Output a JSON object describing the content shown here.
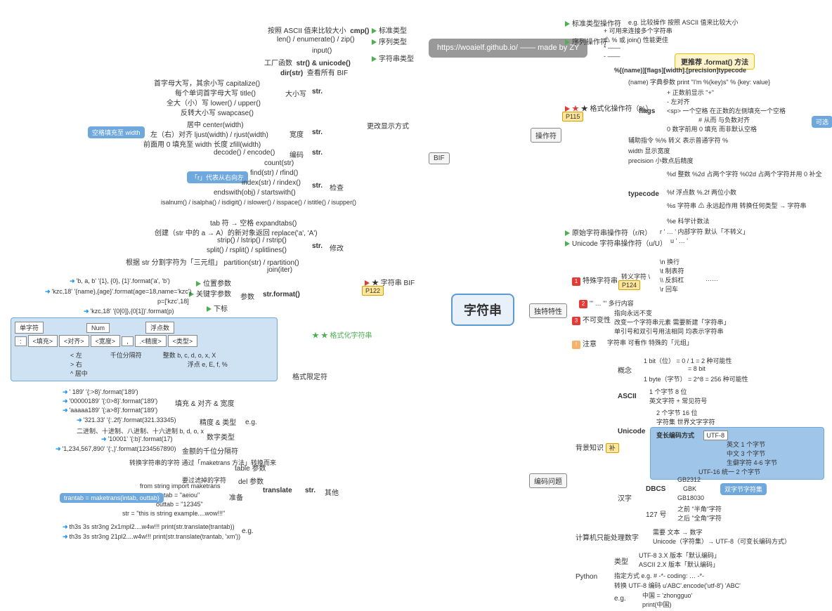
{
  "root": "字符串",
  "watermark": "https://woaielf.github.io/\n—— made by ZY",
  "bif": {
    "title": "BIF",
    "std": {
      "label": "标准类型",
      "items": [
        "按照 ASCII 值来比较大小",
        "cmp()"
      ]
    },
    "seq": {
      "label": "序列类型",
      "item": "len() / enumerate() / zip()"
    },
    "strtype": {
      "label": "字符串类型",
      "input": "input()",
      "factory": "工厂函数",
      "unicode": "str() & unicode()",
      "dir": "dir(str)",
      "dirnote": "查看所有 BIF"
    },
    "str_label": "str.",
    "case": {
      "label": "大小写",
      "items": [
        "首字母大写，其余小写  capitalize()",
        "每个单词首字母大写  title()",
        "全大（小）写  lower() / upper()",
        "反转大小写  swapcase()"
      ]
    },
    "width": {
      "label": "宽度",
      "note": "空格填充至 width",
      "items": [
        "居中  center(width)",
        "左（右）对齐  ljust(width) / rjust(width)",
        "前面用 0 填充至 width 长度  zfill(width)"
      ]
    },
    "encode": {
      "label": "编码",
      "item": "decode() / encode()"
    },
    "display": "更改显示方式",
    "check": {
      "label": "检查",
      "note": "「r」代表从右向左",
      "items": [
        "count(str)",
        "find(str) / rfind()",
        "index(str) / rindex()",
        "endswith(obj) / startswith()",
        "isalnum() / isalpha() / isdigit() / islower() / isspace() / istitle() / isupper()"
      ]
    },
    "modify": {
      "label": "修改",
      "items": [
        "tab 符 → 空格  expandtabs()",
        "创建（str 中的 a → A）的新对象返回  replace('a', 'A')",
        "strip() / lstrip() / rstrip()",
        "split() / rsplit() / splitlines()",
        "根据 str 分割字符为「三元组」  partition(str) / rpartition()",
        "join(iter)"
      ]
    },
    "strbif": {
      "label": "★ 字符串 BIF",
      "tag": "P122"
    }
  },
  "format": {
    "title": "★ 格式化字符串",
    "strformat": "str.format()",
    "param": "参数",
    "pos": {
      "label": "位置参数",
      "ex": "'b, a, b'    '{1}, {0}, {1}'.format('a', 'b')"
    },
    "kw": {
      "label": "关键字参数",
      "ex": "'kzc,18'    '{name},{age}'.format(age=18,name='kzc')"
    },
    "sub": {
      "label": "下标",
      "p": "p=['kzc',18]",
      "ex": "'kzc,18'    '{0[0]},{0[1]}'.format(p)"
    },
    "spec": {
      "label": "格式限定符",
      "header": [
        "单字符",
        "Num",
        "浮点数"
      ],
      "row1": [
        ":",
        "<填充>",
        "<对齐>",
        "<宽度>",
        ",",
        ".<精度>",
        "<类型>"
      ],
      "align": [
        "<  左",
        "千位分隔符",
        "整数  b, c, d, o, x, X",
        "浮点  e, E, f, %",
        "> 右",
        "^ 居中"
      ]
    },
    "eg": {
      "label": "e.g.",
      "fill": "填充 & 对齐 & 宽度",
      "items": [
        "'   189'    '{:>8}'.format('189')",
        "'00000189'    '{:0>8}'.format('189')",
        "'aaaaa189'    '{:a>8}'.format('189')"
      ],
      "prec": "精度 & 类型",
      "prec_ex": "'321.33'    '{:.2f}'.format(321.33345)",
      "numtype": "数字类型",
      "numtype_note": "二进制、十进制、八进制、十六进制  b, d, o, x",
      "numtype_ex": "'10001'    '{:b}'.format(17)",
      "thou": "金额的千位分隔符",
      "thou_ex": "'1,234,567,890'    '{:,}'.format(1234567890)"
    },
    "other": {
      "label": "其他",
      "translate": "translate",
      "tablep": "table 参数",
      "tablep_note": "转换字符串的字符  通过「maketrans 方法」转换而来",
      "delp": "del 参数",
      "delp_note": "要过滤掉的字符",
      "prep": "准备",
      "prep_items": [
        "from string import maketrans",
        "intab = \"aeiou\"",
        "outtab = \"12345\"",
        "str = \"this is string example....wow!!!\""
      ],
      "trantab": "trantab = maketrans(intab, outtab)",
      "eg_items": [
        "th3s 3s str3ng 2x1mpl2....w4w!!!  print(str.translate(trantab))",
        "th3s 3s str3ng 21pl2....w4w!!!  print(str.translate(trantab, 'xm'))"
      ]
    }
  },
  "ops": {
    "title": "操作符",
    "std": {
      "label": "标准类型操作符",
      "eg": "e.g.   比较操作   按照 ASCII 值来比较大小"
    },
    "seq": {
      "label": "序列操作符",
      "plus": "+  可用来连接多个字符串",
      "plusw": "⚠ % 或 join() 性能更佳",
      "star": "*  ——",
      "minus": "-  ——"
    },
    "fmt": {
      "label": "★ 格式化操作符（%）",
      "tag": "P115",
      "rec": "更推荐 .format() 方法",
      "tpl": "%[(name)][flags][width].[precision]typecode",
      "name": "(name)  字典参数  print \"I'm %(key)s\" % {key: value}",
      "flags": "flags",
      "flag_items": [
        "+  正数前显示 \"+\"",
        "-  左对齐",
        "<sp>  一个空格  在正数的左侧填充一个空格",
        "#  从而  与负数对齐",
        "0  数字前用 0 填充  而非默认空格"
      ],
      "opt": "可选",
      "aux": "辅助指令  %%  转义  表示普通字符 %",
      "width": "width  显示宽度",
      "prec": "precision  小数点后精度",
      "typecode": "typecode",
      "tc_items": [
        "%d  整数  %2d  占两个字符    %02d  占两个字符并用 0 补全",
        "%f  浮点数  %.2f  两位小数",
        "%s  字符串  ⚠ 永远起作用  转换任何类型 → 字符串",
        "%e  科学计数法"
      ]
    },
    "raw": {
      "label": "原始字符串操作符（r/R）",
      "ex": "r ' … '   内部字符   默认「不转义」"
    },
    "uni": {
      "label": "Unicode 字符串操作符（u/U）",
      "ex": "u ' … '"
    }
  },
  "unique": {
    "title": "独特特性",
    "esc": {
      "label": "特殊字符串",
      "sub": "转义字符 \\",
      "tag": "P124",
      "items": [
        "\\n  换行",
        "\\t  制表符",
        "\\\\  反斜杠",
        "\\r  回车",
        "……"
      ]
    },
    "triple": "''' … '''  多行内容",
    "immut": {
      "label": "不可变性",
      "items": [
        "指向永远不变",
        "改变一个字符串元素   需要新建「字符串」",
        "单引号和双引号用法相同   均表示字符串"
      ]
    },
    "note": {
      "label": "注意",
      "items": "字符串   可看作   特殊的「元组」"
    }
  },
  "enc": {
    "title": "编码问题",
    "bg": {
      "label": "背景知识",
      "tag": "补"
    },
    "concept": {
      "label": "概念",
      "bit": "1 bit（位）   = 0 / 1 = 2 种可能性",
      "byte1": "= 8 bit",
      "byte2": "1 byte（字节）   = 2^8 = 256 种可能性"
    },
    "ascii": {
      "label": "ASCII",
      "items": [
        "1 个字节   8 位",
        "英文字符 + 常见符号"
      ]
    },
    "unicode": {
      "label": "Unicode",
      "items": [
        "2 个字节   16 位",
        "字符集   世界文字字符"
      ],
      "varlabel": "变长编码方式",
      "utf8": "UTF-8",
      "utf8_items": [
        "英文  1 个字节",
        "中文  3 个字节",
        "生僻字符  4-6 字节"
      ],
      "utf16": "UTF-16   统一   2 个字节"
    },
    "han": {
      "label": "汉字",
      "dbcs": "DBCS",
      "dbcs_items": [
        "GB2312",
        "GBK",
        "GB18030"
      ],
      "dbcs_note": "双字节字符集",
      "127": "127 号",
      "127_items": [
        "之前  \"半角\"字符",
        "之后  \"全角\"字符"
      ]
    },
    "comp": {
      "label": "计算机只能处理数字",
      "need": "需要   文本 → 数字",
      "uni": "Unicode（字符集）→ UTF-8（可变长编码方式）"
    },
    "python": {
      "label": "Python",
      "type": "类型",
      "type_items": [
        "UTF-8   3.X 版本「默认编码」",
        "ASCII   2.X 版本「默认编码」"
      ],
      "spec": "指定方式   e.g.   # -*- coding: … -*-",
      "conv": "转换   UTF-8 编码   u'ABC'.encode('utf-8')   'ABC'",
      "eg": "e.g.",
      "eg_items": [
        "中国 = 'zhongguo'",
        "print(中国)"
      ]
    }
  }
}
